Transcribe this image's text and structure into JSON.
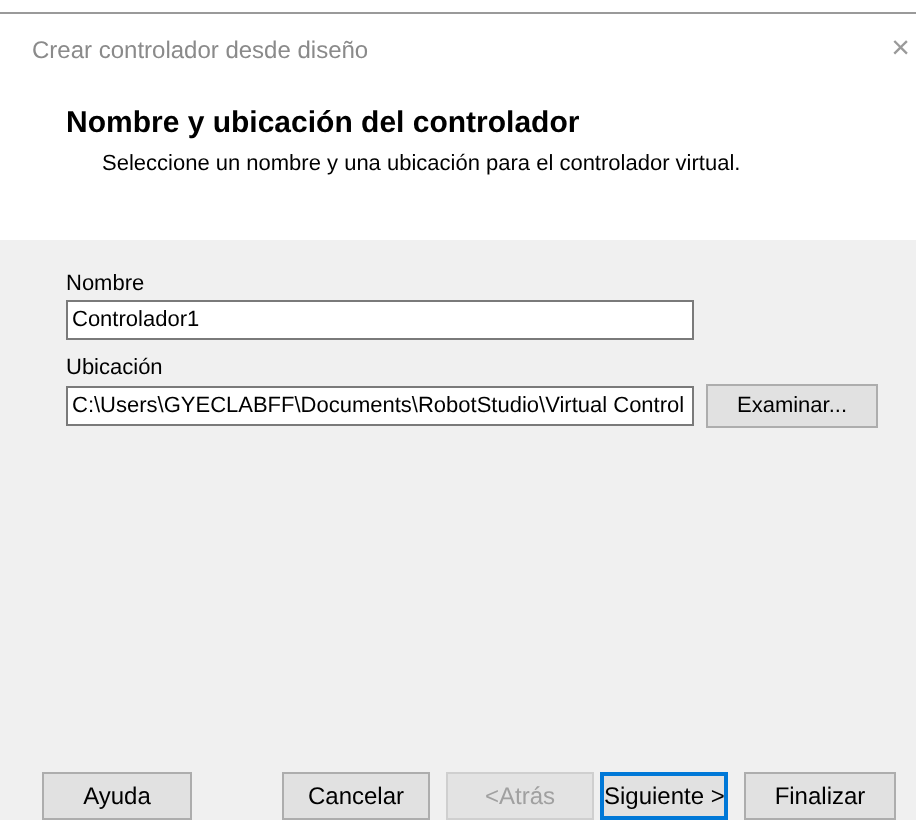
{
  "window": {
    "title": "Crear controlador desde diseño",
    "close": "×"
  },
  "header": {
    "title": "Nombre y ubicación del controlador",
    "subtitle": "Seleccione un nombre y una ubicación para el controlador virtual."
  },
  "fields": [
    {
      "label": "Nombre",
      "value": "Controlador1"
    },
    {
      "label": "Ubicación",
      "value": "C:\\Users\\GYECLABFF\\Documents\\RobotStudio\\Virtual Control",
      "browse": "Examinar..."
    }
  ],
  "buttons": [
    {
      "label": "Ayuda",
      "disabled": false,
      "focused": false
    },
    {
      "label": "Cancelar",
      "disabled": false,
      "focused": false
    },
    {
      "label": "<Atrás",
      "disabled": true,
      "focused": false
    },
    {
      "label": "Siguiente >",
      "disabled": false,
      "focused": true
    },
    {
      "label": "Finalizar",
      "disabled": false,
      "focused": false
    }
  ]
}
